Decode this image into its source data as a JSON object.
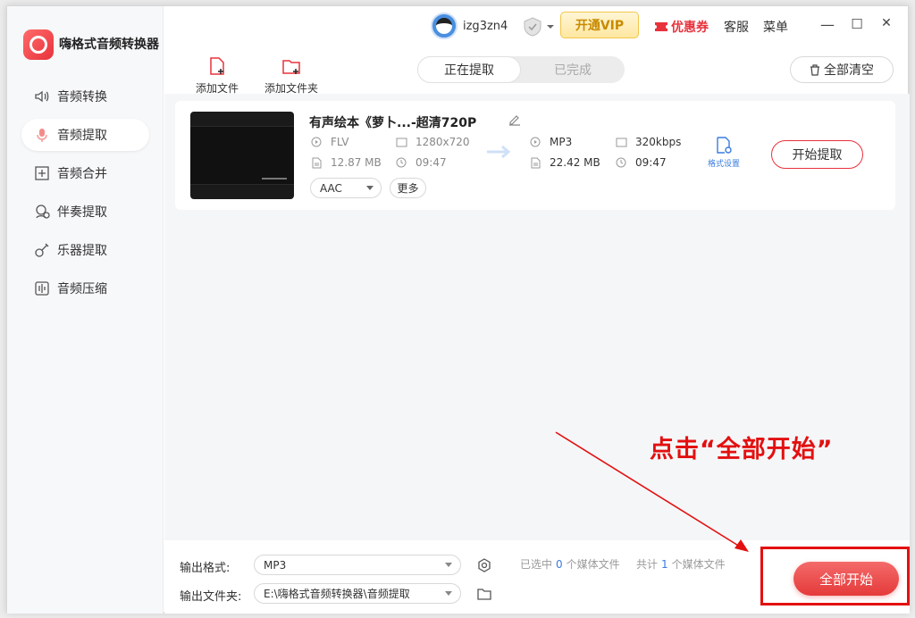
{
  "app": {
    "title": "嗨格式音频转换器"
  },
  "sidebar": {
    "items": [
      {
        "label": "音频转换",
        "icon": "speaker-icon",
        "active": false
      },
      {
        "label": "音频提取",
        "icon": "microphone-icon",
        "active": true
      },
      {
        "label": "音频合并",
        "icon": "merge-icon",
        "active": false
      },
      {
        "label": "伴奏提取",
        "icon": "vocal-remove-icon",
        "active": false
      },
      {
        "label": "乐器提取",
        "icon": "guitar-icon",
        "active": false
      },
      {
        "label": "音频压缩",
        "icon": "compress-icon",
        "active": false
      }
    ]
  },
  "topbar": {
    "username": "izg3zn4",
    "vip_label": "开通VIP",
    "coupon_label": "优惠券",
    "service_label": "客服",
    "menu_label": "菜单",
    "minimize": "—",
    "maximize": "☐",
    "close": "✕"
  },
  "toolbar": {
    "add_file": "添加文件",
    "add_folder": "添加文件夹",
    "tab_extracting": "正在提取",
    "tab_done": "已完成",
    "clear_all": "全部清空"
  },
  "file": {
    "name": "有声绘本《萝卜...-超清720P",
    "source": {
      "format": "FLV",
      "resolution": "1280x720",
      "size": "12.87 MB",
      "duration": "09:47"
    },
    "output": {
      "format": "MP3",
      "bitrate": "320kbps",
      "size": "22.42 MB",
      "duration": "09:47"
    },
    "codec": "AAC",
    "more": "更多",
    "format_settings": "格式设置",
    "start_extract": "开始提取"
  },
  "footer": {
    "output_format_label": "输出格式:",
    "output_format_value": "MP3",
    "output_folder_label": "输出文件夹:",
    "output_folder_value": "E:\\嗨格式音频转换器\\音频提取",
    "selected_prefix": "已选中",
    "selected_count": "0",
    "selected_suffix": "个媒体文件",
    "total_prefix": "共计",
    "total_count": "1",
    "total_suffix": "个媒体文件",
    "start_all": "全部开始"
  },
  "annotation": {
    "callout": "点击“全部开始”"
  },
  "colors": {
    "accent": "#e53a3a",
    "annotation": "#e31010",
    "link": "#3a7ce0",
    "vip": "#c88a00"
  }
}
